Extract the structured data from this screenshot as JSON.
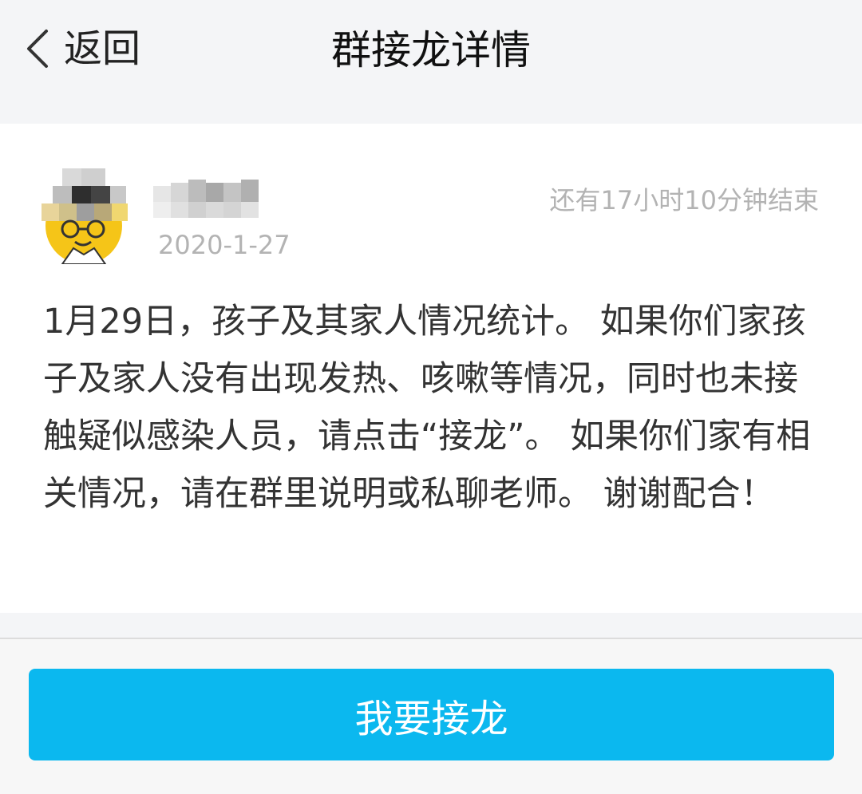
{
  "header": {
    "back_label": "返回",
    "title": "群接龙详情",
    "back_icon": "chevron-left-icon"
  },
  "post": {
    "author_icon": "user-avatar",
    "date": "2020-1-27",
    "remaining": "还有17小时10分钟结束",
    "content": "1月29日，孩子及其家人情况统计。 如果你们家孩子及家人没有出现发热、咳嗽等情况，同时也未接触疑似感染人员，请点击“接龙”。 如果你们家有相关情况，请在群里说明或私聊老师。 谢谢配合！"
  },
  "footer": {
    "join_label": "我要接龙",
    "button_color": "#0bb8ef"
  }
}
